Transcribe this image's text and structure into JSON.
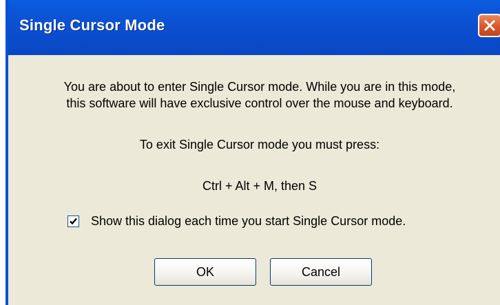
{
  "window": {
    "title": "Single Cursor Mode",
    "close_icon": "close-icon"
  },
  "message": {
    "line1": "You are about to enter Single Cursor mode. While you are in this mode,",
    "line2": "this software will have exclusive control over the mouse and keyboard.",
    "exit_instruction": "To exit Single Cursor mode you must press:",
    "key_combo": "Ctrl + Alt + M, then S"
  },
  "options": {
    "show_dialog_label": "Show this dialog each time you start Single Cursor mode.",
    "show_dialog_checked": true
  },
  "buttons": {
    "ok_label": "OK",
    "cancel_label": "Cancel"
  },
  "colors": {
    "titlebar": "#0b4fd0",
    "close_button": "#d8572c",
    "dialog_background": "#ece9d8"
  }
}
